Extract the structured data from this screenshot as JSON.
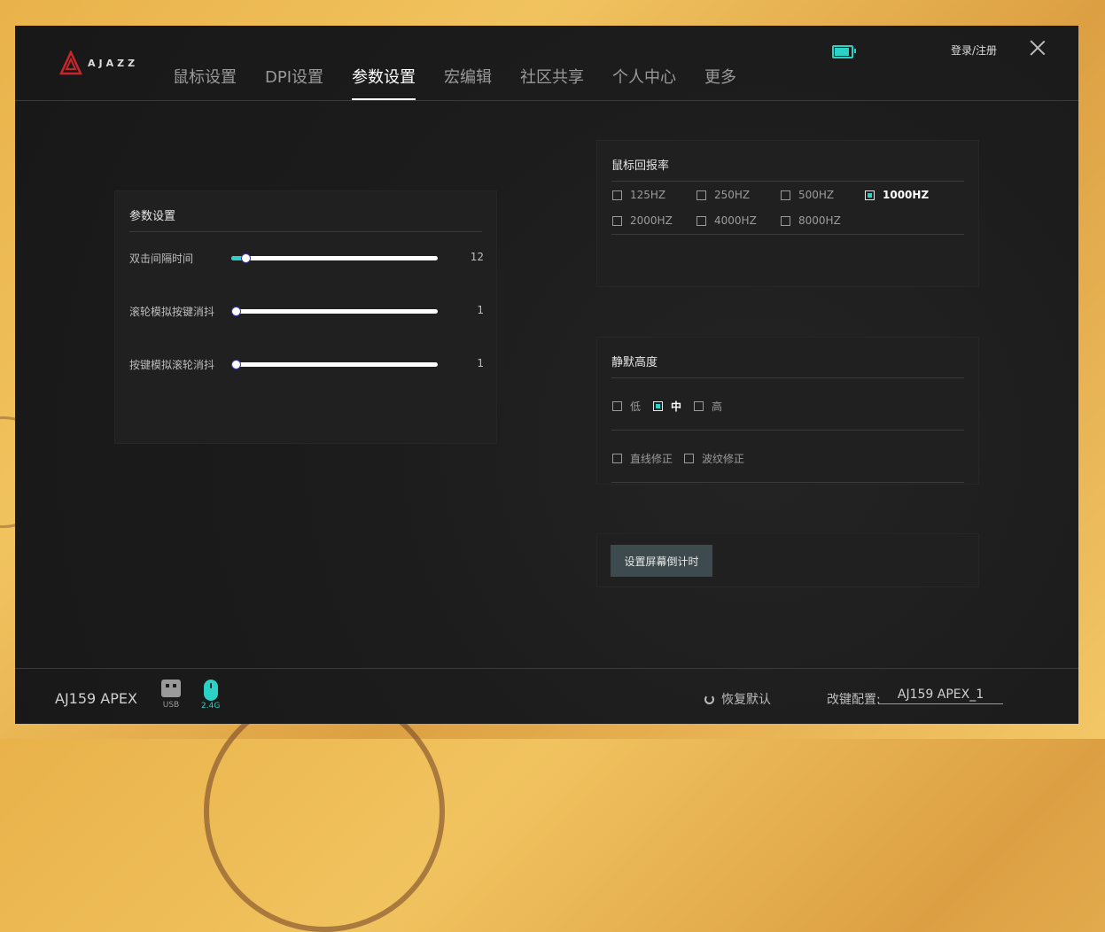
{
  "app": {
    "logo_text": "AJAZZ",
    "login_label": "登录/注册",
    "battery_level": 1.0,
    "accent_color": "#2ad1c4"
  },
  "nav": {
    "tabs": [
      {
        "label": "鼠标设置",
        "active": false
      },
      {
        "label": "DPI设置",
        "active": false
      },
      {
        "label": "参数设置",
        "active": true
      },
      {
        "label": "宏编辑",
        "active": false
      },
      {
        "label": "社区共享",
        "active": false
      },
      {
        "label": "个人中心",
        "active": false
      },
      {
        "label": "更多",
        "active": false
      }
    ]
  },
  "params": {
    "title": "参数设置",
    "sliders": [
      {
        "label": "双击间隔时间",
        "value": "12",
        "fraction": 0.07
      },
      {
        "label": "滚轮模拟按键消抖",
        "value": "1",
        "fraction": 0.0
      },
      {
        "label": "按键模拟滚轮消抖",
        "value": "1",
        "fraction": 0.0
      }
    ]
  },
  "report_rate": {
    "title": "鼠标回报率",
    "options": [
      {
        "label": "125HZ",
        "checked": false
      },
      {
        "label": "250HZ",
        "checked": false
      },
      {
        "label": "500HZ",
        "checked": false
      },
      {
        "label": "1000HZ",
        "checked": true
      },
      {
        "label": "2000HZ",
        "checked": false
      },
      {
        "label": "4000HZ",
        "checked": false
      },
      {
        "label": "8000HZ",
        "checked": false
      }
    ]
  },
  "lod": {
    "title": "静默高度",
    "options": [
      {
        "label": "低",
        "checked": false
      },
      {
        "label": "中",
        "checked": true
      },
      {
        "label": "高",
        "checked": false
      }
    ],
    "extras": [
      {
        "label": "直线修正",
        "checked": false
      },
      {
        "label": "波纹修正",
        "checked": false
      }
    ]
  },
  "countdown": {
    "button_label": "设置屏幕倒计时"
  },
  "footer": {
    "device_name": "AJ159 APEX",
    "usb_label": "USB",
    "wireless_label": "2.4G",
    "restore_label": "恢复默认",
    "profile_label": "改键配置:",
    "profile_value": "AJ159 APEX_1"
  }
}
